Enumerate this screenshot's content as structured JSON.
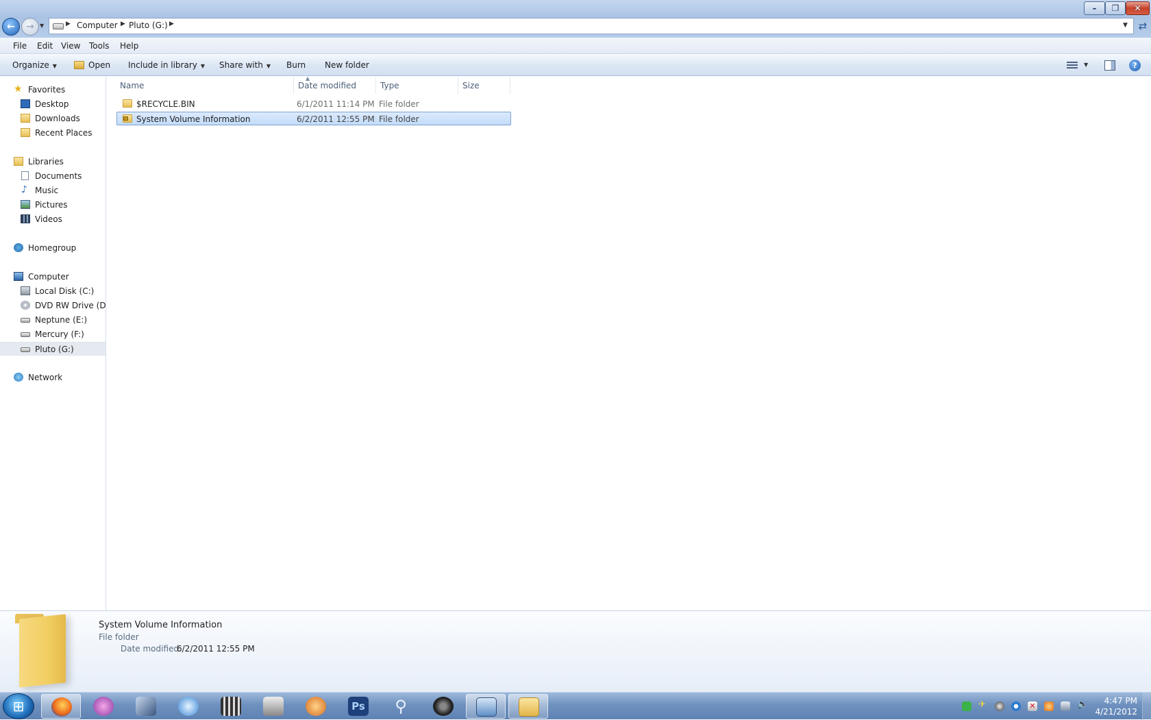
{
  "window": {
    "minimize_glyph": "–",
    "maximize_glyph": "❐",
    "close_glyph": "✕"
  },
  "address": {
    "crumbs": [
      "Computer",
      "Pluto (G:)"
    ],
    "refresh_glyph": "⇄"
  },
  "menu": [
    "File",
    "Edit",
    "View",
    "Tools",
    "Help"
  ],
  "toolbar": {
    "organize": "Organize",
    "open": "Open",
    "include_in_library": "Include in library",
    "share_with": "Share with",
    "burn": "Burn",
    "new_folder": "New folder",
    "help_glyph": "?"
  },
  "nav": {
    "favorites": "Favorites",
    "desktop": "Desktop",
    "downloads": "Downloads",
    "recent_places": "Recent Places",
    "libraries": "Libraries",
    "documents": "Documents",
    "music": "Music",
    "pictures": "Pictures",
    "videos": "Videos",
    "homegroup": "Homegroup",
    "computer": "Computer",
    "local_disk": "Local Disk (C:)",
    "dvd_drive": "DVD RW Drive (D:) F",
    "neptune": "Neptune (E:)",
    "mercury": "Mercury (F:)",
    "pluto": "Pluto (G:)",
    "network": "Network"
  },
  "columns": {
    "name": "Name",
    "date_modified": "Date modified",
    "type": "Type",
    "size": "Size"
  },
  "files": [
    {
      "name": "$RECYCLE.BIN",
      "date": "6/1/2011 11:14 PM",
      "type": "File folder",
      "size": ""
    },
    {
      "name": "System Volume Information",
      "date": "6/2/2011 12:55 PM",
      "type": "File folder",
      "size": ""
    }
  ],
  "details": {
    "name": "System Volume Information",
    "type": "File folder",
    "date_label": "Date modified:",
    "date_value": "6/2/2011 12:55 PM"
  },
  "taskbar": {
    "start_glyph": "⊞",
    "apps": [
      "firefox",
      "media-center",
      "pinnacle",
      "itunes",
      "video-editor",
      "camcorder",
      "messenger",
      "photoshop",
      "search",
      "webcam",
      "remote-desktop",
      "windows-explorer"
    ],
    "photoshop_label": "Ps",
    "time": "4:47 PM",
    "date": "4/21/2012"
  },
  "colors": {
    "selection": "#cce4fb",
    "accent": "#2464b8"
  }
}
